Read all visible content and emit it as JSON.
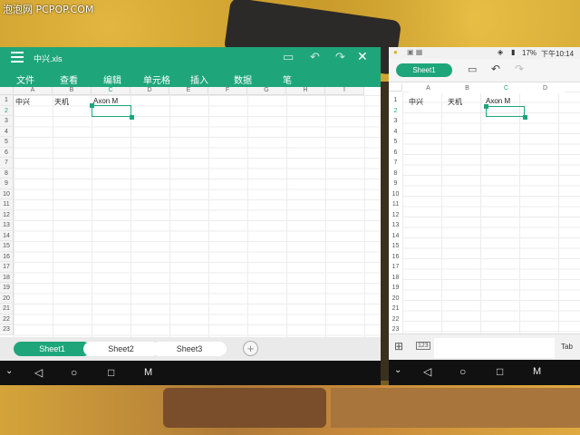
{
  "watermark": "泡泡网 PCPOP.COM",
  "left": {
    "file_name": "中兴.xls",
    "menu": [
      "文件",
      "查看",
      "编辑",
      "单元格",
      "插入",
      "数据",
      "笔"
    ],
    "columns": [
      "A",
      "B",
      "C",
      "D",
      "E",
      "F",
      "G",
      "H",
      "I"
    ],
    "rows": [
      "1",
      "2",
      "3",
      "4",
      "5",
      "6",
      "7",
      "8",
      "9",
      "10",
      "11",
      "12",
      "13",
      "14",
      "15",
      "16",
      "17",
      "18",
      "19",
      "20",
      "21",
      "22",
      "23"
    ],
    "cells": {
      "A1": "中兴",
      "B1": "天机",
      "C1": "Axon M"
    },
    "selected_cell": "C2",
    "sheet_tabs": [
      "Sheet1",
      "Sheet2",
      "Sheet3"
    ],
    "active_sheet": "Sheet1",
    "add_tab_symbol": "+",
    "icons": [
      "menu-icon",
      "save-icon",
      "undo-icon",
      "redo-icon",
      "close-icon"
    ]
  },
  "right": {
    "status": {
      "battery": "17%",
      "time": "下午10:14"
    },
    "sheet_button": "Sheet1",
    "columns": [
      "A",
      "B",
      "C",
      "D"
    ],
    "rows": [
      "1",
      "2",
      "3",
      "4",
      "5",
      "6",
      "7",
      "8",
      "9",
      "10",
      "11",
      "12",
      "13",
      "14",
      "15",
      "16",
      "17",
      "18",
      "19",
      "20",
      "21",
      "22",
      "23"
    ],
    "cells": {
      "A1": "中兴",
      "B1": "天机",
      "C1": "Axon M"
    },
    "bottom": {
      "keypad_label": "123",
      "tab_label": "Tab"
    }
  },
  "nav_buttons": [
    "back-icon",
    "home-icon",
    "recents-icon",
    "menu-m-icon"
  ],
  "colors": {
    "accent": "#1ea67a",
    "nav": "#111111"
  }
}
